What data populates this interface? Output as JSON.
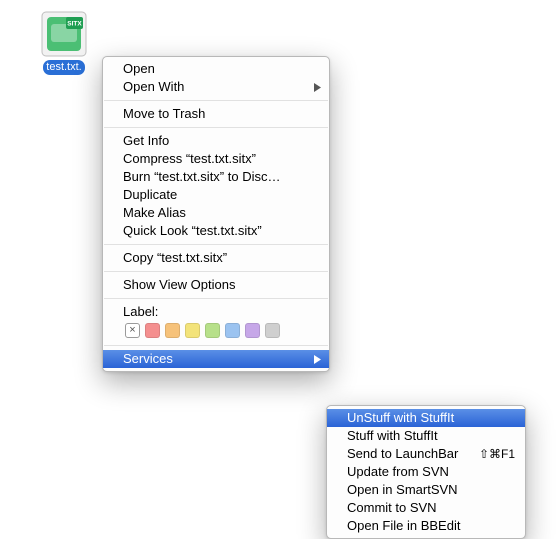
{
  "file": {
    "name": "test.txt.sitx",
    "badge": "SITX",
    "displayed_label": "test.txt."
  },
  "menu": {
    "open": "Open",
    "open_with": "Open With",
    "move_to_trash": "Move to Trash",
    "get_info": "Get Info",
    "compress": "Compress “test.txt.sitx”",
    "burn": "Burn “test.txt.sitx” to Disc…",
    "duplicate": "Duplicate",
    "make_alias": "Make Alias",
    "quick_look": "Quick Look “test.txt.sitx”",
    "copy": "Copy “test.txt.sitx”",
    "view_options": "Show View Options",
    "label_header": "Label:",
    "services": "Services"
  },
  "label_colors": {
    "none": "#ffffff",
    "red": "#f48f8f",
    "orange": "#f6c27a",
    "yellow": "#f3e37a",
    "green": "#b7e08a",
    "blue": "#9bc3f0",
    "purple": "#c6a7e8",
    "gray": "#cfcfcf"
  },
  "services": {
    "unstuff": "UnStuff with StuffIt",
    "stuff": "Stuff with StuffIt",
    "launchbar": {
      "label": "Send to LaunchBar",
      "shortcut": "⇧⌘F1"
    },
    "svn_update": "Update from SVN",
    "smartsvn": "Open in SmartSVN",
    "svn_commit": "Commit to SVN",
    "bbedit": "Open File in BBEdit"
  }
}
